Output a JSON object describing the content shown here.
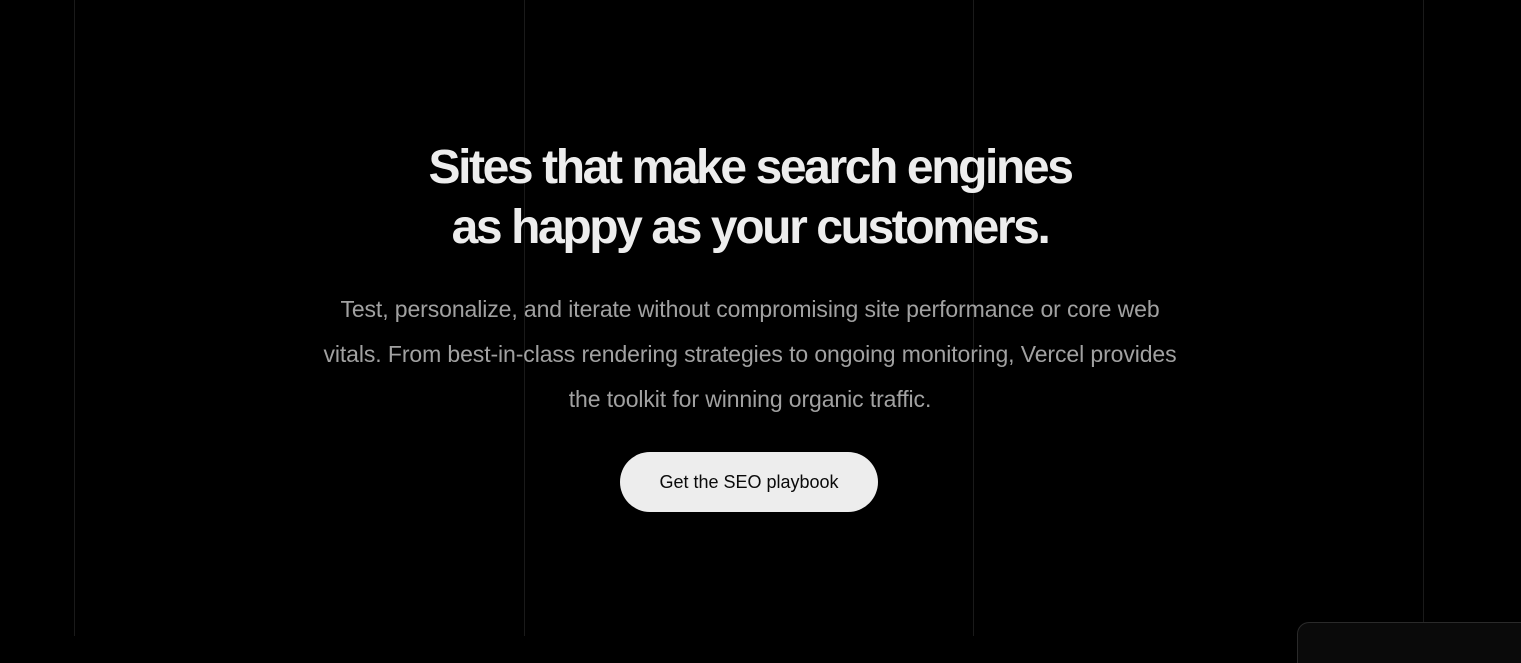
{
  "hero": {
    "headline_line1": "Sites that make search engines",
    "headline_line2": "as happy as your customers.",
    "subtext_line1": "Test, personalize, and iterate without compromising site performance or core web",
    "subtext_line2": "vitals. From best-in-class rendering strategies to ongoing monitoring, Vercel provides",
    "subtext_line3": "the toolkit for winning organic traffic.",
    "cta_label": "Get the SEO playbook"
  },
  "colors": {
    "background": "#000000",
    "headline": "#ededed",
    "subtext": "#a1a1a1",
    "button_bg": "#ededed",
    "button_text": "#0a0a0a",
    "grid_line": "#1a1a1a"
  }
}
